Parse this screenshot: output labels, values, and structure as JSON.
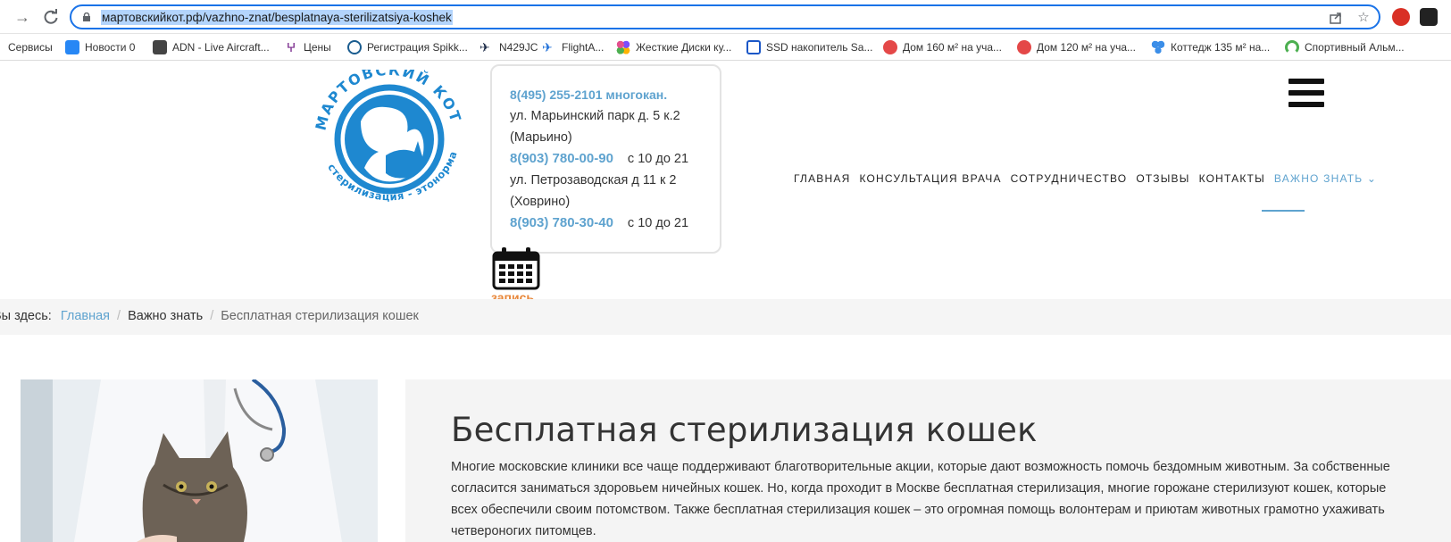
{
  "browser": {
    "url": "мартовскийкот.рф/vazhno-znat/besplatnaya-sterilizatsiya-koshek",
    "bookmarks": [
      {
        "label": "Сервисы",
        "icon": "apps-grid-icon",
        "color": "#4a4a4a"
      },
      {
        "label": "Новости 0",
        "icon": "vk-icon",
        "color": "#2787f5"
      },
      {
        "label": "ADN - Live Aircraft...",
        "icon": "plane-site-icon",
        "color": "#333333"
      },
      {
        "label": "Цены",
        "icon": "branch-icon",
        "color": "#7b2d8e"
      },
      {
        "label": "Регистрация Spikk...",
        "icon": "globe-icon",
        "color": "#1a5c8f"
      },
      {
        "label": "N429JC",
        "icon": "plane-icon",
        "color": "#1c2b48"
      },
      {
        "label": "FlightA...",
        "icon": "flightaware-icon",
        "color": "#1c6ed8"
      },
      {
        "label": "Жесткие Диски ку...",
        "icon": "dots-icon",
        "color": "#e44f8f"
      },
      {
        "label": "SSD накопитель Sa...",
        "icon": "ssd-icon",
        "color": "#1b57c7"
      },
      {
        "label": "Дом 160 м² на уча...",
        "icon": "red-circle-icon",
        "color": "#e44848"
      },
      {
        "label": "Дом 120 м² на уча...",
        "icon": "red-circle-icon",
        "color": "#e44848"
      },
      {
        "label": "Коттедж 135 м² на...",
        "icon": "dots-icon",
        "color": "#3b8ee8"
      },
      {
        "label": "Спортивный Альм...",
        "icon": "arc-icon",
        "color": "#4caf50"
      }
    ]
  },
  "site": {
    "accent": "#5fa3cf",
    "logo_brand": "МАРТОВСКИЙ КОТ",
    "logo_tagline": "стерилизация - этонорма",
    "contacts": {
      "phone_main": "8(495) 255-2101 многокан.",
      "address_1": "ул. Марьинский парк д. 5 к.2",
      "district_1": "(Марьино)",
      "phone_1": "8(903) 780-00-90",
      "hours_1": "с 10 до 21",
      "address_2": "ул. Петрозаводская д 11 к 2",
      "district_2": "(Ховрино)",
      "phone_2": "8(903) 780-30-40",
      "hours_2": "с 10 до 21"
    },
    "appointment_label": "запись",
    "menu": [
      {
        "label": "ГЛАВНАЯ"
      },
      {
        "label": "КОНСУЛЬТАЦИЯ ВРАЧА"
      },
      {
        "label": "СОТРУДНИЧЕСТВО"
      },
      {
        "label": "ОТЗЫВЫ"
      },
      {
        "label": "КОНТАКТЫ"
      },
      {
        "label": "ВАЖНО ЗНАТЬ ⌄"
      }
    ]
  },
  "breadcrumb": {
    "prefix": "Вы здесь:",
    "home": "Главная",
    "section": "Важно знать",
    "current": "Бесплатная стерилизация кошек"
  },
  "article": {
    "title": "Бесплатная стерилизация кошек",
    "lines": [
      "Многие московские клиники все чаще поддерживают благотворительные акции, которые дают возможность помочь бездомным животным. За собственные",
      "согласится заниматься здоровьем ничейных кошек. Но, когда проходит в Москве бесплатная стерилизация, многие горожане стерилизуют кошек, которые",
      "всех обеспечили своим потомством. Также бесплатная стерилизация кошек – это огромная помощь волонтерам и приютам животных грамотно ухаживать",
      "четвероногих питомцев."
    ]
  }
}
